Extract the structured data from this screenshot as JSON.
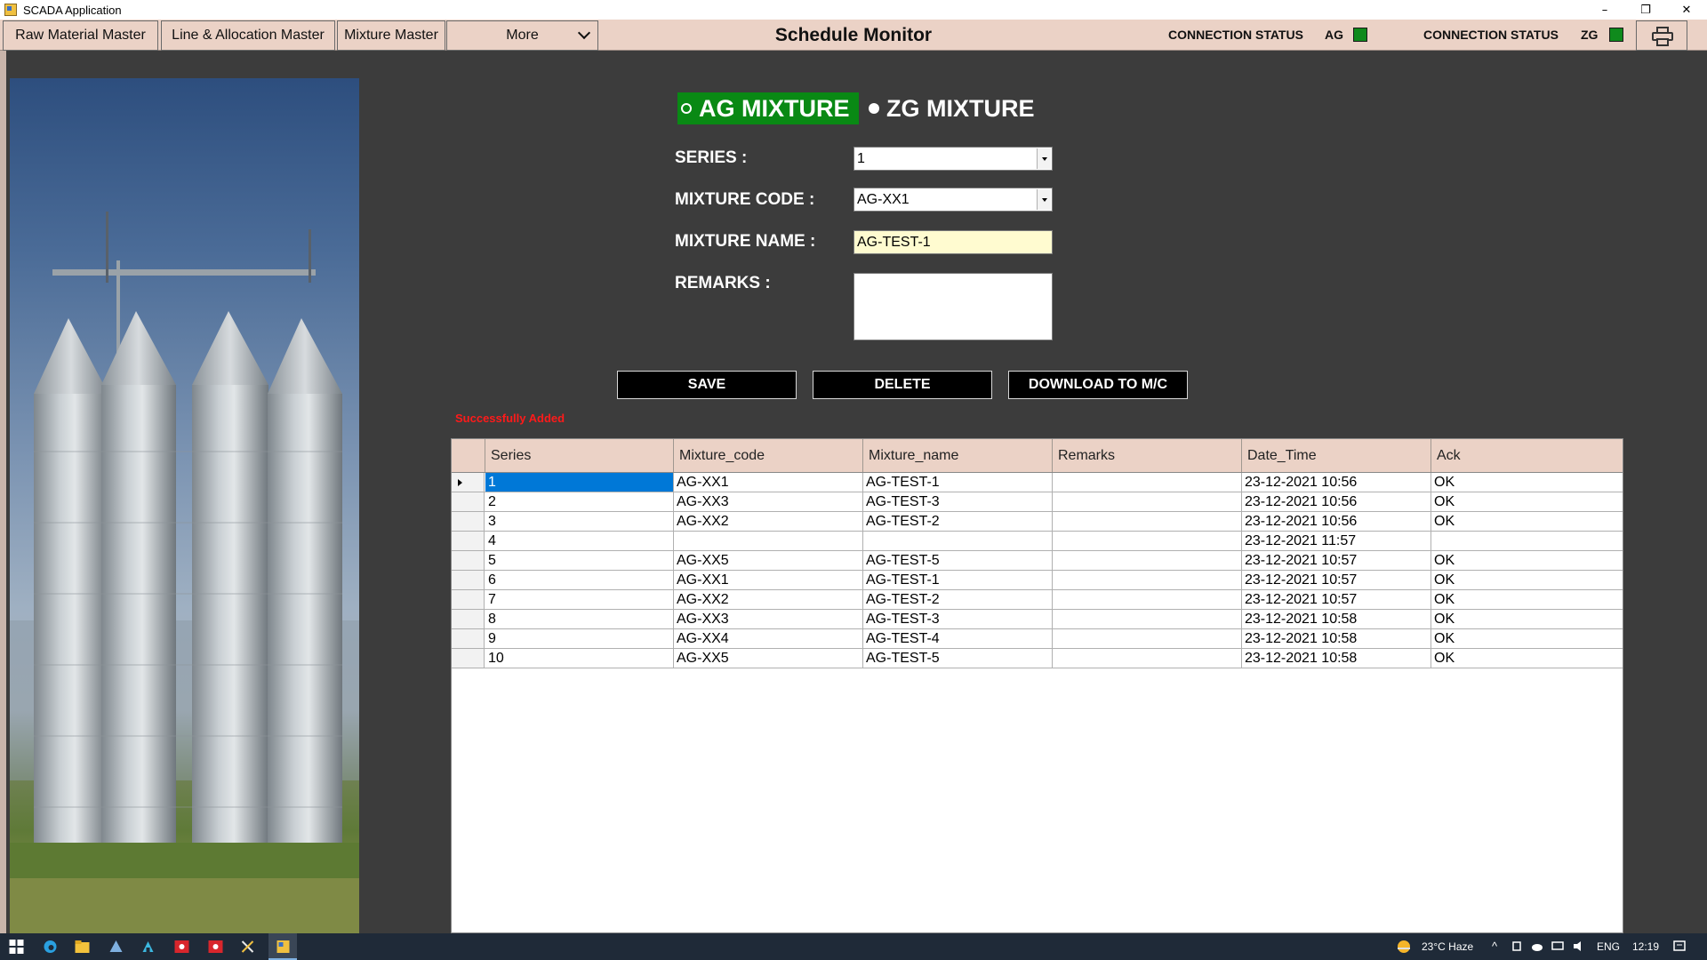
{
  "window": {
    "title": "SCADA Application",
    "minimize": "–",
    "restore": "❐",
    "close": "✕"
  },
  "menu": {
    "raw_material": "Raw Material Master",
    "line_allocation": "Line & Allocation Master",
    "mixture_master": "Mixture Master",
    "more": "More"
  },
  "header": {
    "title": "Schedule Monitor",
    "conn_status_label": "CONNECTION STATUS",
    "conn_ag_tag": "AG",
    "conn_zg_tag": "ZG",
    "status_color": "#0f8a1c"
  },
  "mixture_type": {
    "ag_label": "AG MIXTURE",
    "zg_label": "ZG MIXTURE",
    "selected": "AG MIXTURE"
  },
  "form": {
    "series_label": "SERIES :",
    "series_value": "1",
    "mixture_code_label": "MIXTURE CODE :",
    "mixture_code_value": "AG-XX1",
    "mixture_name_label": "MIXTURE NAME :",
    "mixture_name_value": "AG-TEST-1",
    "remarks_label": "REMARKS :",
    "remarks_value": ""
  },
  "actions": {
    "save": "SAVE",
    "delete": "DELETE",
    "download": "DOWNLOAD TO M/C"
  },
  "status_message": "Successfully Added",
  "grid": {
    "columns": [
      "Series",
      "Mixture_code",
      "Mixture_name",
      "Remarks",
      "Date_Time",
      "Ack"
    ],
    "rows": [
      [
        "1",
        "AG-XX1",
        "AG-TEST-1",
        "",
        "23-12-2021 10:56",
        "OK"
      ],
      [
        "2",
        "AG-XX3",
        "AG-TEST-3",
        "",
        "23-12-2021 10:56",
        "OK"
      ],
      [
        "3",
        "AG-XX2",
        "AG-TEST-2",
        "",
        "23-12-2021 10:56",
        "OK"
      ],
      [
        "4",
        "",
        "",
        "",
        "23-12-2021 11:57",
        ""
      ],
      [
        "5",
        "AG-XX5",
        "AG-TEST-5",
        "",
        "23-12-2021 10:57",
        "OK"
      ],
      [
        "6",
        "AG-XX1",
        "AG-TEST-1",
        "",
        "23-12-2021 10:57",
        "OK"
      ],
      [
        "7",
        "AG-XX2",
        "AG-TEST-2",
        "",
        "23-12-2021 10:57",
        "OK"
      ],
      [
        "8",
        "AG-XX3",
        "AG-TEST-3",
        "",
        "23-12-2021 10:58",
        "OK"
      ],
      [
        "9",
        "AG-XX4",
        "AG-TEST-4",
        "",
        "23-12-2021 10:58",
        "OK"
      ],
      [
        "10",
        "AG-XX5",
        "AG-TEST-5",
        "",
        "23-12-2021 10:58",
        "OK"
      ]
    ],
    "selected_row": 0
  },
  "taskbar": {
    "weather": "23°C  Haze",
    "language": "ENG",
    "time": "12:19"
  }
}
